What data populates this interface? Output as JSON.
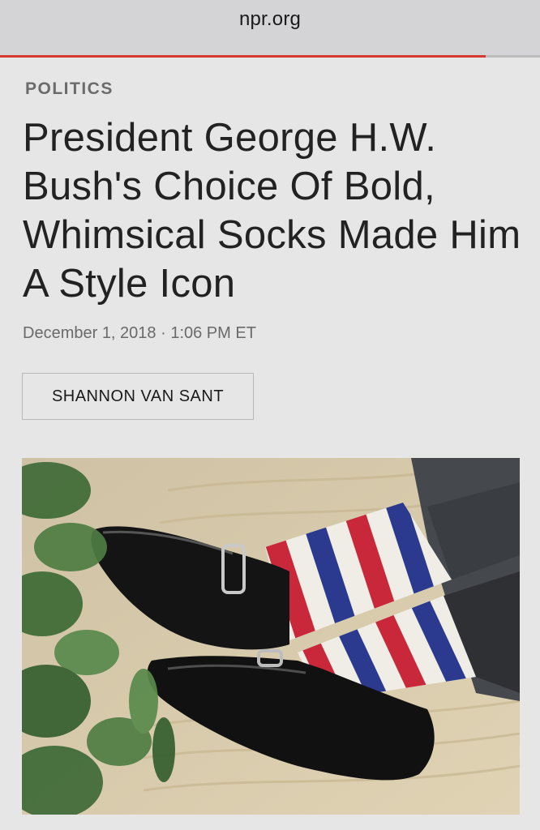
{
  "browser": {
    "domain": "npr.org",
    "load_progress": 0.9,
    "load_color": "#d6392f"
  },
  "article": {
    "section": "POLITICS",
    "headline": "President George H.W. Bush's Choice Of Bold, Whimsical Socks Made Him A Style Icon",
    "dateline": "December 1, 2018 · 1:06 PM ET",
    "author": "SHANNON VAN SANT"
  },
  "photo": {
    "subject": "legs-crossed-in-striped-socks-and-loafers",
    "sock_stripe_colors": [
      "#c8283a",
      "#f0ece6",
      "#2b3a8f"
    ],
    "shoe_color": "#141414",
    "trouser_color": "#45484c",
    "carpet_color": "#d9c9a6",
    "plant_color": "#3e6a36"
  }
}
